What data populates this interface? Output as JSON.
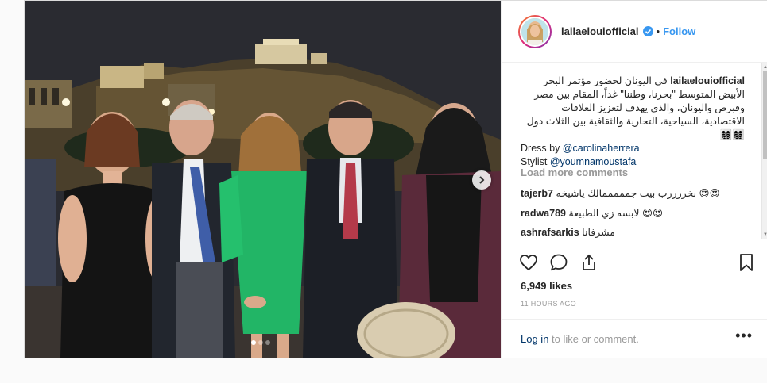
{
  "post": {
    "username": "lailaelouiofficial",
    "follow_label": "Follow",
    "separator": "•",
    "caption_text_ar": "في اليونان لحضور مؤتمر البحر الأبيض المتوسط \"بحرنا، وطننا\" غداً، المقام بين مصر وقبرص واليونان، والذي يهدف لتعزيز العلاقات الاقتصادية، السياحية، التجارية والثقافية بين الثلاث دول 👩‍👩‍👧‍👦👩‍👩‍👧‍👦",
    "caption_dress_prefix": "Dress by ",
    "caption_dress_mention": "@carolinaherrera",
    "caption_stylist_prefix": "Stylist ",
    "caption_stylist_mention": "@youmnamoustafa",
    "load_more_label": "Load more comments",
    "comments": [
      {
        "user": "tajerb7",
        "text": "بخررررب بيت جمممممالك ياشيخه 😍😍"
      },
      {
        "user": "radwa789",
        "text": "لابسه زي الطبيعة 😍😍"
      },
      {
        "user": "ashrafsarkis",
        "text": "مشرفانا"
      }
    ],
    "likes_text": "6,949 likes",
    "timestamp": "11 HOURS AGO",
    "login_link": "Log in",
    "login_suffix": " to like or comment.",
    "more_options": "•••"
  },
  "carousel": {
    "slide_count": 3,
    "active_index": 0
  },
  "icons": {
    "verified": "verified-badge-icon",
    "like": "heart-icon",
    "comment": "comment-icon",
    "share": "share-icon",
    "save": "bookmark-icon",
    "next": "chevron-right-icon",
    "scroll_up": "▲",
    "scroll_down": "▼"
  },
  "colors": {
    "link": "#003569",
    "follow": "#3897f0",
    "muted": "#999999",
    "verified": "#3897f0"
  }
}
